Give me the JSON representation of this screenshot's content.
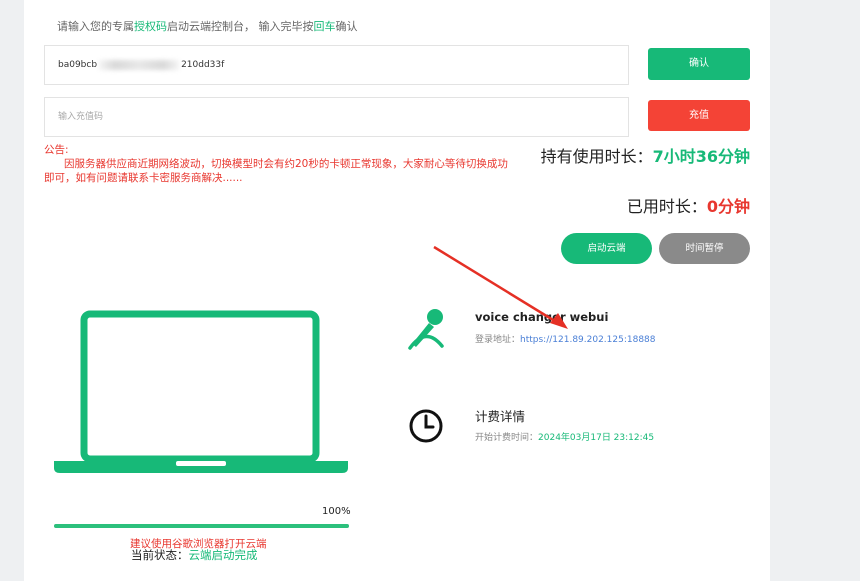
{
  "prompt": {
    "part1": "请输入您的专属",
    "link1": "授权码",
    "part2": "启动云端控制台， 输入完毕按",
    "link2": "回车",
    "part3": "确认"
  },
  "auth_input": {
    "value_start": "ba09bcb",
    "value_end": "210dd33f"
  },
  "confirm_button": "确认",
  "recharge_input": {
    "placeholder": "输入充值码"
  },
  "recharge_button": "充值",
  "notice": {
    "title": "公告:",
    "body": "因服务器供应商近期网络波动，切换模型时会有约20秒的卡顿正常现象，大家耐心等待切换成功即可，如有问题请联系卡密服务商解决......"
  },
  "stats": {
    "held_label": "持有使用时长：",
    "held_value": "7小时36分钟",
    "used_label": "已用时长：",
    "used_value": "0分钟"
  },
  "actions": {
    "start_cloud": "启动云端",
    "pause_time": "时间暂停"
  },
  "service": {
    "name": "voice changer webui",
    "addr_label": "登录地址：",
    "addr": "https://121.89.202.125:18888"
  },
  "billing": {
    "title": "计费详情",
    "start_label": "开始计费时间：",
    "start_value": "2024年03月17日 23:12:45"
  },
  "progress": {
    "percent_text": "100%",
    "fraction": 1.0
  },
  "browser_hint": "建议使用谷歌浏览器打开云端",
  "status": {
    "label": "当前状态：",
    "value": "云端启动完成"
  },
  "colors": {
    "accent": "#17b978",
    "danger": "#f44336",
    "grey_button": "#8a8a8a",
    "notice": "#e8372f",
    "link": "#4a7fd6"
  }
}
